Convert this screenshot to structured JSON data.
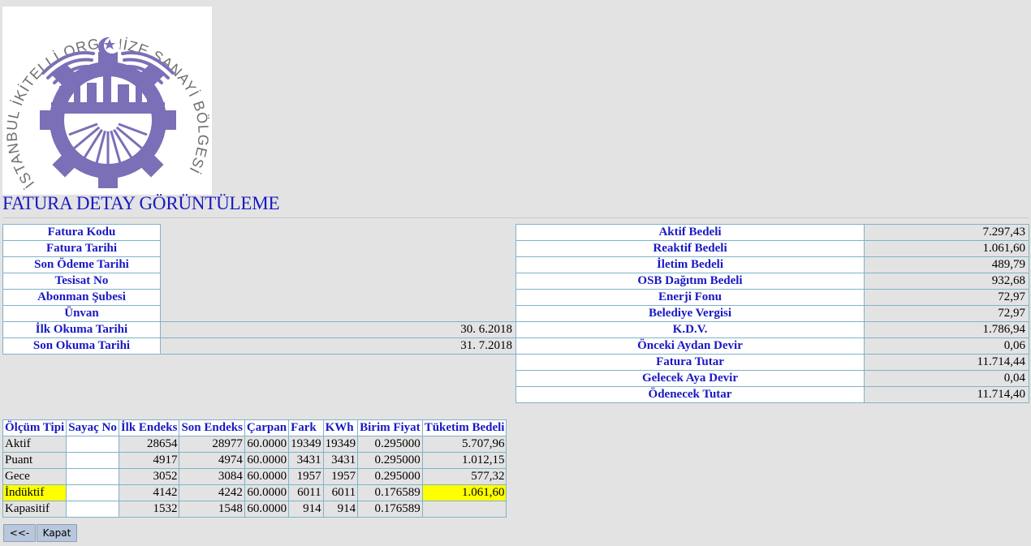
{
  "logo": {
    "text_ring": "İSTANBUL İKİTELLİ ORGANİZE SANAYİ BÖLGESİ BAŞKANLIĞI"
  },
  "page": {
    "title": "FATURA DETAY GÖRÜNTÜLEME"
  },
  "invoice_left": [
    {
      "label": "Fatura Kodu",
      "value": ""
    },
    {
      "label": "Fatura Tarihi",
      "value": ""
    },
    {
      "label": "Son Ödeme Tarihi",
      "value": ""
    },
    {
      "label": "Tesisat No",
      "value": ""
    },
    {
      "label": "Abonman Şubesi",
      "value": ""
    },
    {
      "label": "Ünvan",
      "value": ""
    },
    {
      "label": "İlk Okuma Tarihi",
      "value": "30. 6.2018"
    },
    {
      "label": "Son Okuma Tarihi",
      "value": "31. 7.2018"
    }
  ],
  "invoice_right": [
    {
      "label": "Aktif Bedeli",
      "value": "7.297,43"
    },
    {
      "label": "Reaktif Bedeli",
      "value": "1.061,60"
    },
    {
      "label": "İletim Bedeli",
      "value": "489,79"
    },
    {
      "label": "OSB Dağıtım Bedeli",
      "value": "932,68"
    },
    {
      "label": "Enerji Fonu",
      "value": "72,97"
    },
    {
      "label": "Belediye Vergisi",
      "value": "72,97"
    },
    {
      "label": "K.D.V.",
      "value": "1.786,94"
    },
    {
      "label": "Önceki Aydan Devir",
      "value": "0,06"
    },
    {
      "label": "Fatura Tutar",
      "value": "11.714,44"
    },
    {
      "label": "Gelecek Aya Devir",
      "value": "0,04"
    },
    {
      "label": "Ödenecek Tutar",
      "value": "11.714,40"
    }
  ],
  "meter_table": {
    "headers": [
      "Ölçüm Tipi",
      "Sayaç No",
      "İlk Endeks",
      "Son Endeks",
      "Çarpan",
      "Fark",
      "KWh",
      "Birim Fiyat",
      "Tüketim Bedeli"
    ],
    "rows": [
      [
        "Aktif",
        "",
        "28654",
        "28977",
        "60.0000",
        "19349",
        "19349",
        "0.295000",
        "5.707,96"
      ],
      [
        "Puant",
        "",
        "4917",
        "4974",
        "60.0000",
        "3431",
        "3431",
        "0.295000",
        "1.012,15"
      ],
      [
        "Gece",
        "",
        "3052",
        "3084",
        "60.0000",
        "1957",
        "1957",
        "0.295000",
        "577,32"
      ],
      [
        "İndüktif",
        "",
        "4142",
        "4242",
        "60.0000",
        "6011",
        "6011",
        "0.176589",
        "1.061,60"
      ],
      [
        "Kapasitif",
        "",
        "1532",
        "1548",
        "60.0000",
        "914",
        "914",
        "0.176589",
        ""
      ]
    ],
    "highlight_color": "#ffff00"
  },
  "buttons": {
    "back": "<<-",
    "close": "Kapat"
  },
  "colors": {
    "label_blue": "#1818c4",
    "logo_purple": "#7b6fb8",
    "border": "#7fb3c8"
  }
}
